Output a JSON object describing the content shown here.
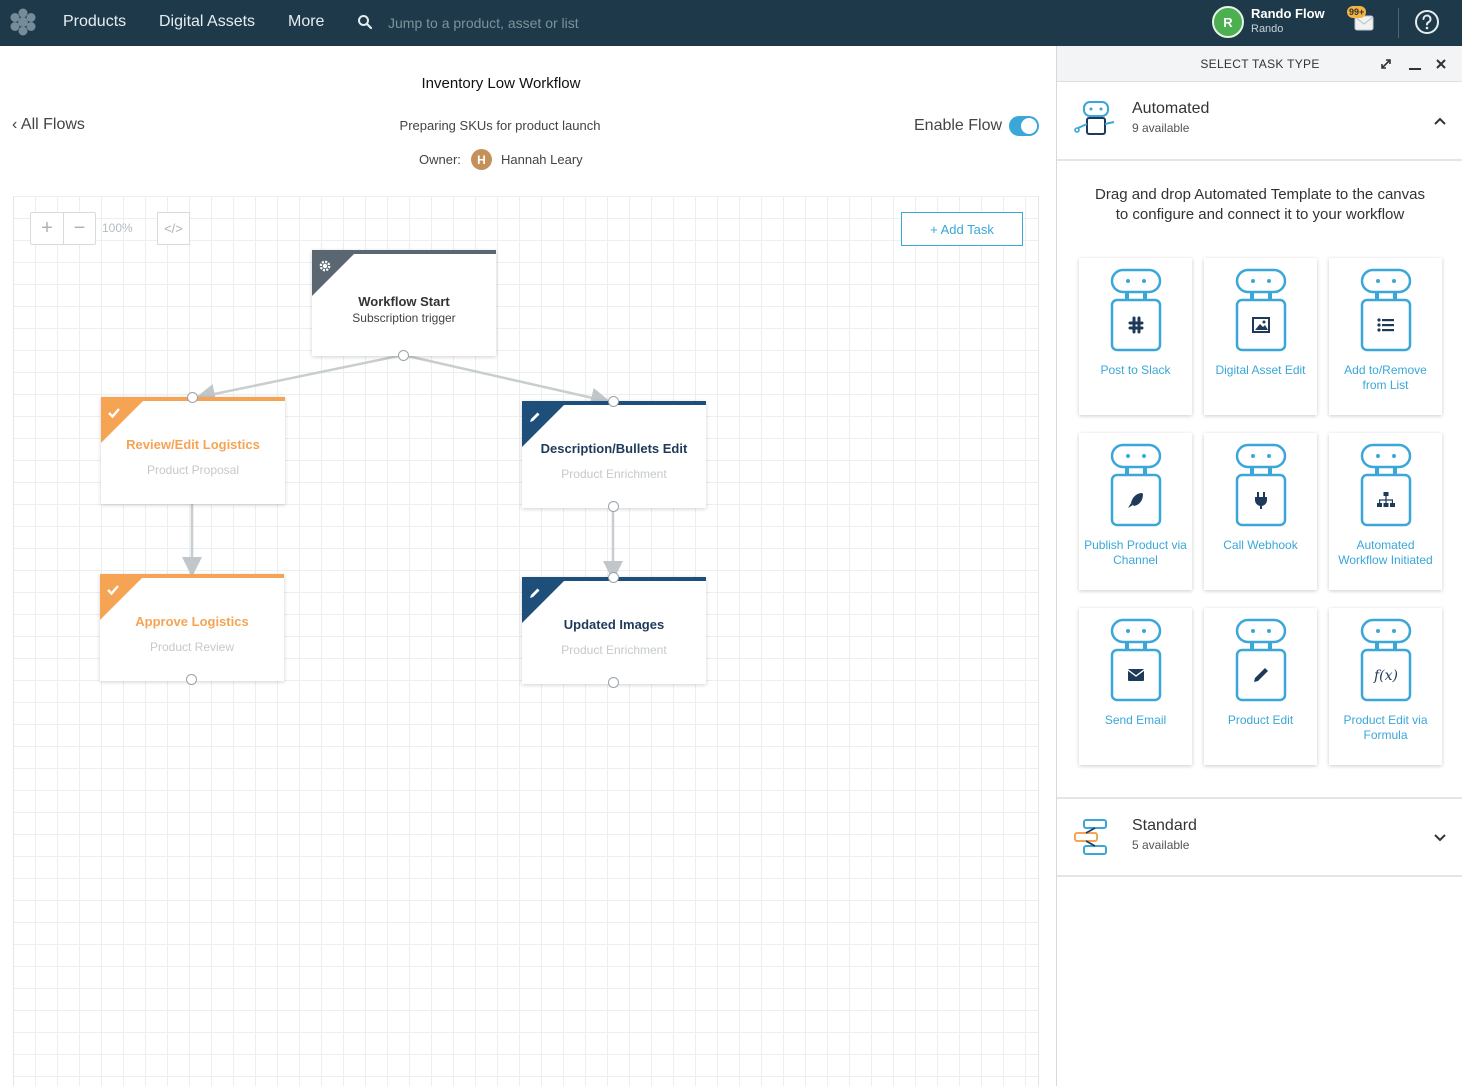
{
  "nav": {
    "items": [
      "Products",
      "Digital Assets",
      "More"
    ],
    "search_placeholder": "Jump to a product, asset or list",
    "user_initial": "R",
    "user_name": "Rando Flow",
    "user_sub": "Rando",
    "notification_badge": "99+"
  },
  "header": {
    "title": "Inventory Low Workflow",
    "back_link": "All Flows",
    "description": "Preparing SKUs for product launch",
    "owner_label": "Owner:",
    "owner_initial": "H",
    "owner_name": "Hannah Leary",
    "enable_label": "Enable Flow",
    "enabled": true
  },
  "canvas": {
    "zoom_level": "100%",
    "add_task_label": "+ Add Task",
    "nodes": [
      {
        "title": "Workflow Start",
        "subtitle": "Subscription trigger",
        "kind": "start",
        "color": "#5a6670"
      },
      {
        "title": "Review/Edit Logistics",
        "subtitle": "Product Proposal",
        "kind": "approval",
        "color": "#f5a454"
      },
      {
        "title": "Description/Bullets Edit",
        "subtitle": "Product Enrichment",
        "kind": "edit",
        "color": "#1e4e7a"
      },
      {
        "title": "Approve Logistics",
        "subtitle": "Product Review",
        "kind": "approval",
        "color": "#f5a454"
      },
      {
        "title": "Updated Images",
        "subtitle": "Product Enrichment",
        "kind": "edit",
        "color": "#1e4e7a"
      }
    ]
  },
  "panel": {
    "title": "SELECT TASK TYPE",
    "automated": {
      "title": "Automated",
      "count": "9 available",
      "expanded": true
    },
    "hint_line1": "Drag and drop Automated Template to the canvas",
    "hint_line2": "to configure and connect it to your workflow",
    "cards": [
      {
        "label": "Post to Slack",
        "icon": "slack-icon"
      },
      {
        "label": "Digital Asset Edit",
        "icon": "image-icon"
      },
      {
        "label": "Add to/Remove from List",
        "icon": "list-icon"
      },
      {
        "label": "Publish Product via Channel",
        "icon": "rocket-icon"
      },
      {
        "label": "Call Webhook",
        "icon": "plug-icon"
      },
      {
        "label": "Automated Workflow Initiated",
        "icon": "sitemap-icon"
      },
      {
        "label": "Send Email",
        "icon": "envelope-icon"
      },
      {
        "label": "Product Edit",
        "icon": "pencil-icon"
      },
      {
        "label": "Product Edit via Formula",
        "icon": "formula-icon"
      }
    ],
    "standard": {
      "title": "Standard",
      "count": "5 available",
      "expanded": false
    }
  },
  "colors": {
    "nav_bg": "#1e3a4a",
    "accent": "#3aa7d8",
    "approval": "#f5a454",
    "edit": "#1e4e7a"
  }
}
